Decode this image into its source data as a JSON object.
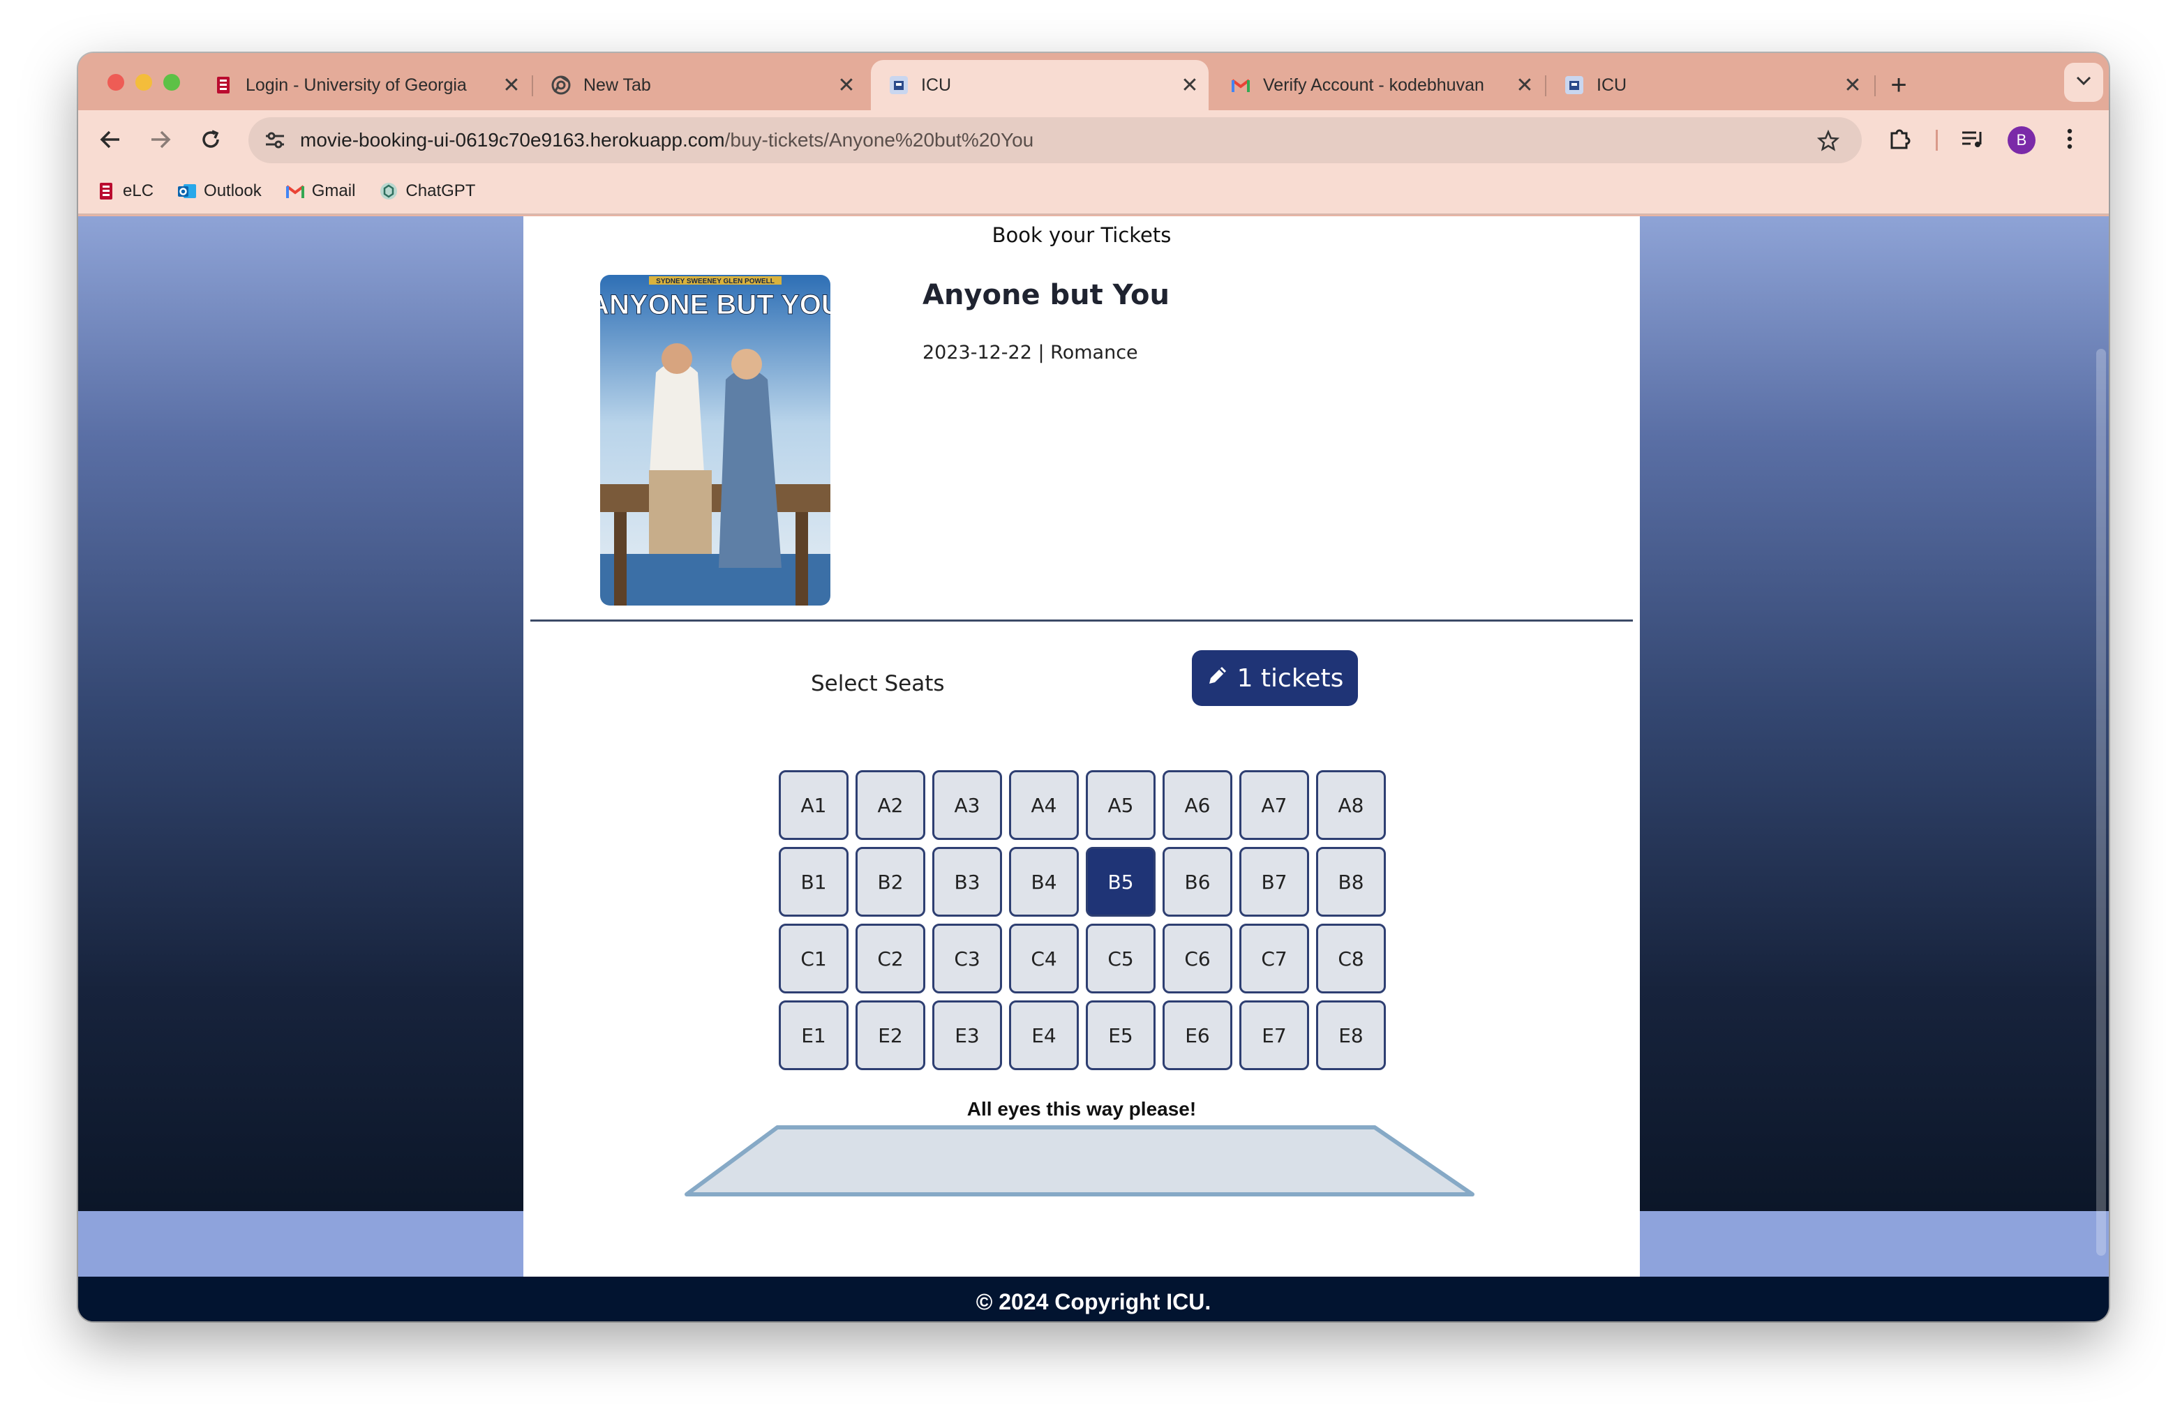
{
  "browser": {
    "tabs": [
      {
        "title": "Login - University of Georgia",
        "icon": "uga-icon",
        "active": false
      },
      {
        "title": "New Tab",
        "icon": "chrome-icon",
        "active": false
      },
      {
        "title": "ICU",
        "icon": "icu-icon",
        "active": true
      },
      {
        "title": "Verify Account - kodebhuvan",
        "icon": "gmail-icon",
        "active": false
      },
      {
        "title": "ICU",
        "icon": "icu-icon",
        "active": false
      }
    ],
    "close_glyph": "✕",
    "new_tab_glyph": "+",
    "url_host": "movie-booking-ui-0619c70e9163.herokuapp.com",
    "url_path": "/buy-tickets/Anyone%20but%20You",
    "profile_initial": "B",
    "bookmarks": [
      {
        "label": "eLC",
        "icon": "elc-icon"
      },
      {
        "label": "Outlook",
        "icon": "outlook-icon"
      },
      {
        "label": "Gmail",
        "icon": "gmail-icon"
      },
      {
        "label": "ChatGPT",
        "icon": "chatgpt-icon"
      }
    ]
  },
  "page": {
    "heading": "Book your Tickets",
    "movie": {
      "title": "Anyone but You",
      "meta": "2023-12-22 | Romance",
      "poster_text": "ANYONE BUT YOU",
      "poster_top_names": "SYDNEY SWEENEY    GLEN POWELL"
    },
    "select_seats_label": "Select Seats",
    "tickets_button": "1 tickets",
    "seat_rows": [
      [
        "A1",
        "A2",
        "A3",
        "A4",
        "A5",
        "A6",
        "A7",
        "A8"
      ],
      [
        "B1",
        "B2",
        "B3",
        "B4",
        "B5",
        "B6",
        "B7",
        "B8"
      ],
      [
        "C1",
        "C2",
        "C3",
        "C4",
        "C5",
        "C6",
        "C7",
        "C8"
      ],
      [
        "E1",
        "E2",
        "E3",
        "E4",
        "E5",
        "E6",
        "E7",
        "E8"
      ]
    ],
    "selected_seats": [
      "B5"
    ],
    "screen_label": "All eyes this way please!",
    "footer": "© 2024 Copyright ICU."
  },
  "colors": {
    "accent": "#1f3476",
    "seat_bg": "#dfe3ea",
    "footer_bg": "#021430"
  }
}
